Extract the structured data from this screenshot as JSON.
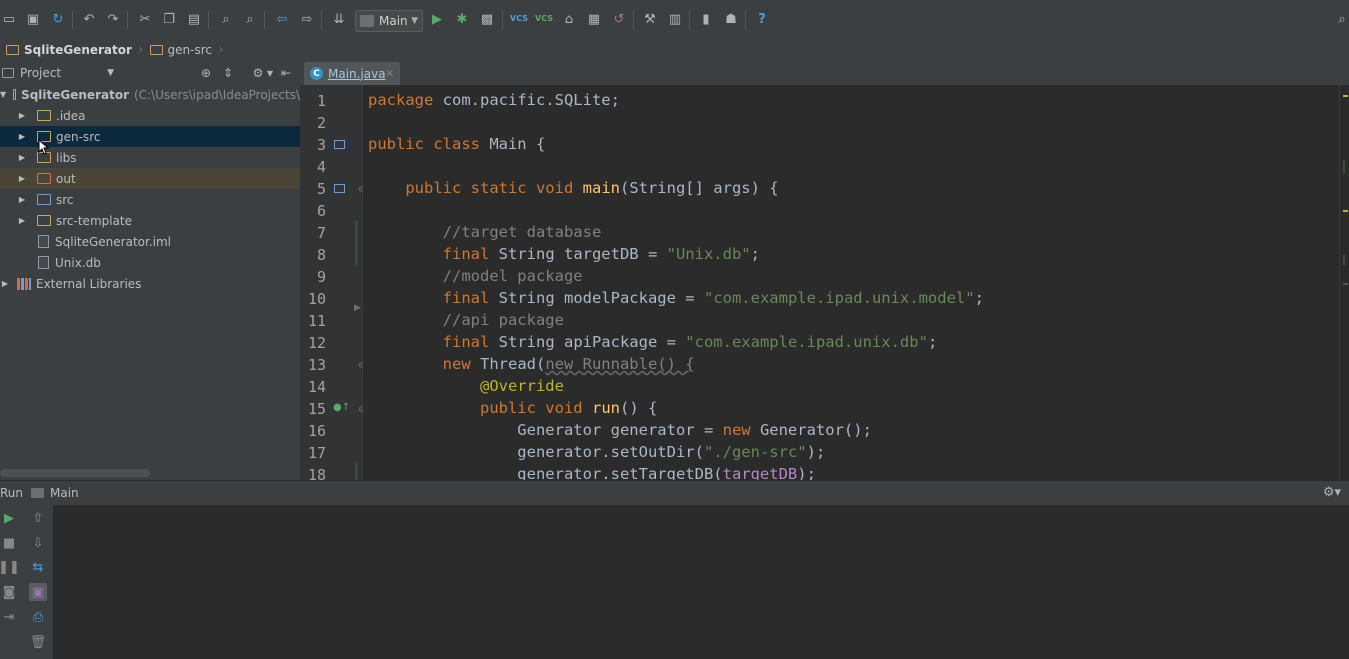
{
  "toolbar": {
    "run_config": "Main",
    "icons": [
      "open-icon",
      "save-icon",
      "sync-icon",
      "undo-icon",
      "redo-icon",
      "cut-icon",
      "copy-icon",
      "paste-icon",
      "find-icon",
      "replace-icon",
      "back-icon",
      "forward-icon",
      "make-icon",
      "run-icon",
      "debug-icon",
      "coverage-icon",
      "vcs-update-icon",
      "vcs-commit-icon",
      "vcs-compare-icon",
      "vcs-history-icon",
      "vcs-revert-icon",
      "settings-icon",
      "structure-icon",
      "sdk-icon",
      "android-icon",
      "help-icon",
      "search-icon"
    ],
    "vcs_label_1": "VCS",
    "vcs_label_2": "VCS",
    "help": "?"
  },
  "breadcrumb": [
    "SqliteGenerator",
    "gen-src"
  ],
  "project_panel": {
    "view_mode": "Project",
    "root": {
      "name": "SqliteGenerator",
      "path": "(C:\\Users\\ipad\\IdeaProjects\\"
    },
    "items": [
      {
        "label": ".idea",
        "type": "folder"
      },
      {
        "label": "gen-src",
        "type": "folder"
      },
      {
        "label": "libs",
        "type": "folder"
      },
      {
        "label": "out",
        "type": "folder-excluded"
      },
      {
        "label": "src",
        "type": "folder-source"
      },
      {
        "label": "src-template",
        "type": "folder"
      },
      {
        "label": "SqliteGenerator.iml",
        "type": "file"
      },
      {
        "label": "Unix.db",
        "type": "file"
      }
    ],
    "external_libraries": "External Libraries"
  },
  "editor": {
    "tab": {
      "label": "Main.java",
      "icon": "C",
      "close": "×"
    },
    "line_numbers": [
      "1",
      "2",
      "3",
      "4",
      "5",
      "6",
      "7",
      "8",
      "9",
      "10",
      "11",
      "12",
      "13",
      "14",
      "15",
      "16",
      "17",
      "18"
    ]
  },
  "run_panel": {
    "label": "Run",
    "config": "Main"
  },
  "colors": {
    "background": "#2b2b2b",
    "keyword": "#cc7832",
    "string": "#6a8759",
    "comment": "#808080",
    "function": "#ffc66d",
    "annotation": "#bbb529",
    "selection": "#0d293e"
  }
}
